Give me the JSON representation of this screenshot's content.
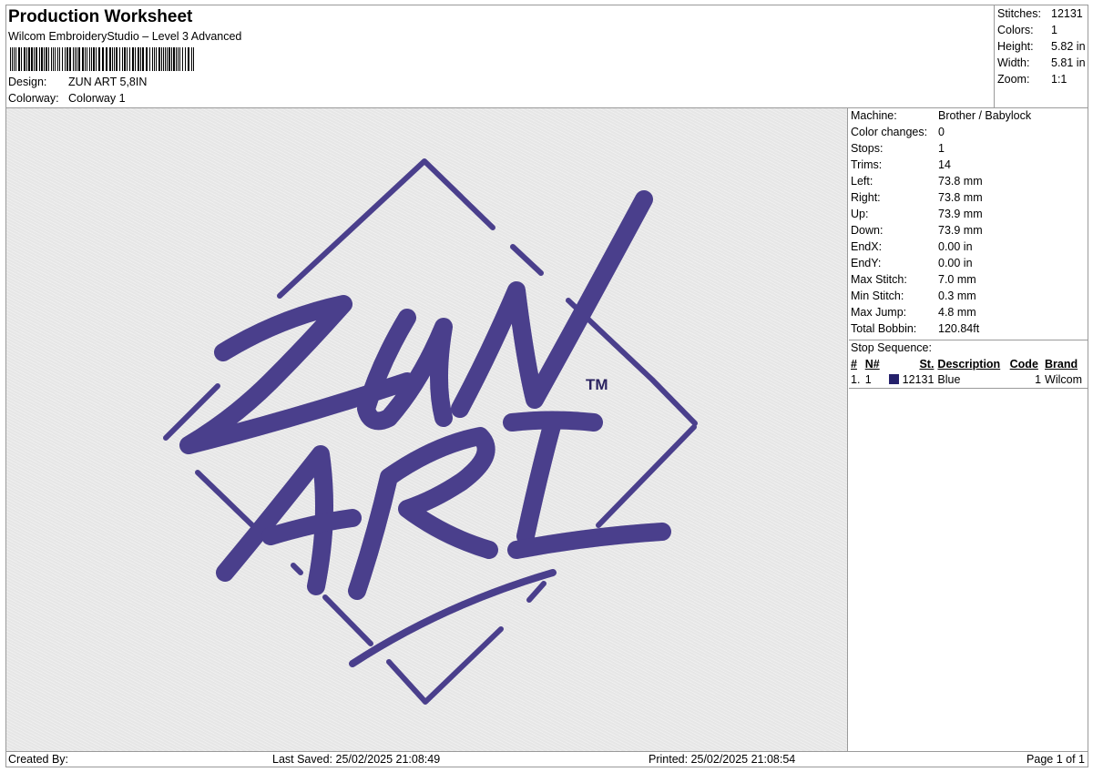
{
  "header": {
    "title": "Production Worksheet",
    "subtitle": "Wilcom EmbroideryStudio – Level 3 Advanced",
    "design_label": "Design:",
    "design_value": "ZUN ART 5,8IN",
    "colorway_label": "Colorway:",
    "colorway_value": "Colorway 1"
  },
  "stats": [
    {
      "label": "Stitches:",
      "value": "12131"
    },
    {
      "label": "Colors:",
      "value": "1"
    },
    {
      "label": "Height:",
      "value": "5.82 in"
    },
    {
      "label": "Width:",
      "value": "5.81 in"
    },
    {
      "label": "Zoom:",
      "value": "1:1"
    }
  ],
  "machine_info": [
    {
      "label": "Machine:",
      "value": "Brother / Babylock"
    },
    {
      "label": "Color changes:",
      "value": "0"
    },
    {
      "label": "Stops:",
      "value": "1"
    },
    {
      "label": "Trims:",
      "value": "14"
    },
    {
      "label": "Left:",
      "value": "73.8 mm"
    },
    {
      "label": "Right:",
      "value": "73.8 mm"
    },
    {
      "label": "Up:",
      "value": "73.9 mm"
    },
    {
      "label": "Down:",
      "value": "73.9 mm"
    },
    {
      "label": "EndX:",
      "value": "0.00 in"
    },
    {
      "label": "EndY:",
      "value": "0.00 in"
    },
    {
      "label": "Max Stitch:",
      "value": "7.0 mm"
    },
    {
      "label": "Min Stitch:",
      "value": "0.3 mm"
    },
    {
      "label": "Max Jump:",
      "value": "4.8 mm"
    },
    {
      "label": "Total Bobbin:",
      "value": "120.84ft"
    }
  ],
  "stop_sequence": {
    "title": "Stop Sequence:",
    "columns": [
      "#",
      "N#",
      "St.",
      "Description",
      "Code",
      "Brand"
    ],
    "rows": [
      {
        "num": "1.",
        "n": "1",
        "color": "#25216b",
        "st": "12131",
        "description": "Blue",
        "code": "1",
        "brand": "Wilcom"
      }
    ]
  },
  "design_preview": {
    "thread_color": "#4a3f8c",
    "thread_shadow": "#2b2360",
    "background": "#e6e6e6",
    "trademark": "TM"
  },
  "footer": {
    "created": "Created By:",
    "saved": "Last Saved: 25/02/2025 21:08:49",
    "printed": "Printed: 25/02/2025 21:08:54",
    "page": "Page 1 of 1"
  }
}
